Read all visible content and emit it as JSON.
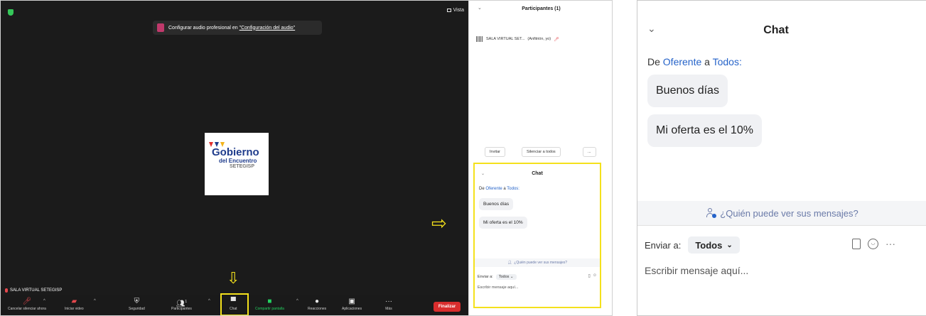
{
  "meeting": {
    "view_label": "Vista",
    "toast_text": "Configurar audio profesional en ",
    "toast_link": "\"Configuración del audio\"",
    "logo": {
      "line1": "Gobierno",
      "line2": "del Encuentro",
      "line3": "SETEGISP"
    },
    "self_name": "SALA VIRTUAL SETEGISP",
    "toolbar": {
      "mute": "Cancelar silenciar ahora",
      "video": "Iniciar video",
      "security": "Seguridad",
      "participants": "Participantes",
      "participants_count": "1",
      "chat": "Chat",
      "share": "Compartir pantalla",
      "reactions": "Reacciones",
      "apps": "Aplicaciones",
      "more": "Más",
      "end": "Finalizar"
    },
    "colors": {
      "highlight": "#f4e11c",
      "end": "#d92d2d",
      "share": "#23d160"
    }
  },
  "participants_panel": {
    "title": "Participantes (1)",
    "row_name": "SALA VIRTUAL SET...",
    "row_role": "(Anfitrión, yo)",
    "invite": "Invitar",
    "mute_all": "Silenciar a todos",
    "more": "..."
  },
  "chat_small": {
    "title": "Chat",
    "from_prefix": "De",
    "sender": "Oferente",
    "to_word": "a",
    "recipient": "Todos:",
    "messages": [
      "Buenos días",
      "Mi oferta es el 10%"
    ],
    "who_can_see": "¿Quién puede ver sus mensajes?",
    "send_to_label": "Enviar a:",
    "send_to_value": "Todos",
    "placeholder": "Escribir mensaje aquí..."
  },
  "chat": {
    "title": "Chat",
    "from_prefix": "De",
    "sender": "Oferente",
    "to_word": "a",
    "recipient": "Todos:",
    "messages": [
      "Buenos días",
      "Mi oferta es el 10%"
    ],
    "who_can_see": "¿Quién puede ver sus mensajes?",
    "send_to_label": "Enviar a:",
    "send_to_value": "Todos",
    "more": "···",
    "placeholder": "Escribir mensaje aquí..."
  }
}
